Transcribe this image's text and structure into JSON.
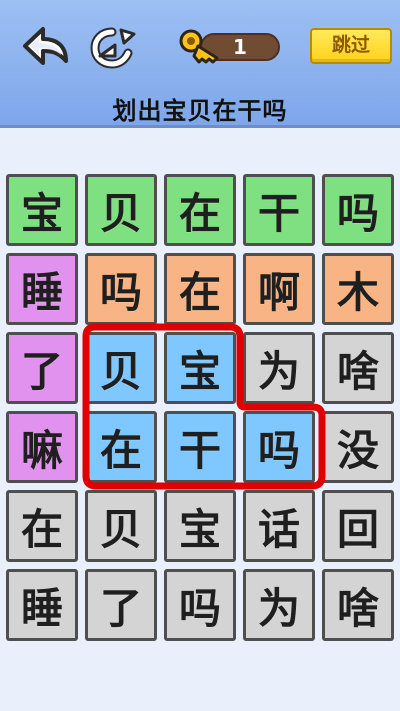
{
  "header": {
    "key_count": "1",
    "skip_label": "跳过",
    "title": "划出宝贝在干吗"
  },
  "icons": {
    "back": "back-arrow-icon",
    "refresh": "refresh-icon",
    "key": "key-icon"
  },
  "board": {
    "rows": [
      [
        {
          "char": "宝",
          "color": "#7fe082"
        },
        {
          "char": "贝",
          "color": "#7fe082"
        },
        {
          "char": "在",
          "color": "#7fe082"
        },
        {
          "char": "干",
          "color": "#7fe082"
        },
        {
          "char": "吗",
          "color": "#7fe082"
        }
      ],
      [
        {
          "char": "睡",
          "color": "#e191ee"
        },
        {
          "char": "吗",
          "color": "#f8b484"
        },
        {
          "char": "在",
          "color": "#f8b484"
        },
        {
          "char": "啊",
          "color": "#f8b484"
        },
        {
          "char": "木",
          "color": "#f8b484"
        }
      ],
      [
        {
          "char": "了",
          "color": "#e191ee"
        },
        {
          "char": "贝",
          "color": "#7ec7ff"
        },
        {
          "char": "宝",
          "color": "#7ec7ff"
        },
        {
          "char": "为",
          "color": "#d4d4d4"
        },
        {
          "char": "啥",
          "color": "#d4d4d4"
        }
      ],
      [
        {
          "char": "嘛",
          "color": "#e191ee"
        },
        {
          "char": "在",
          "color": "#7ec7ff"
        },
        {
          "char": "干",
          "color": "#7ec7ff"
        },
        {
          "char": "吗",
          "color": "#7ec7ff"
        },
        {
          "char": "没",
          "color": "#d4d4d4"
        }
      ],
      [
        {
          "char": "在",
          "color": "#d4d4d4"
        },
        {
          "char": "贝",
          "color": "#d4d4d4"
        },
        {
          "char": "宝",
          "color": "#d4d4d4"
        },
        {
          "char": "话",
          "color": "#d4d4d4"
        },
        {
          "char": "回",
          "color": "#d4d4d4"
        }
      ],
      [
        {
          "char": "睡",
          "color": "#d4d4d4"
        },
        {
          "char": "了",
          "color": "#d4d4d4"
        },
        {
          "char": "吗",
          "color": "#d4d4d4"
        },
        {
          "char": "为",
          "color": "#d4d4d4"
        },
        {
          "char": "啥",
          "color": "#d4d4d4"
        }
      ]
    ]
  },
  "selection": {
    "outline_color": "#e00000"
  }
}
